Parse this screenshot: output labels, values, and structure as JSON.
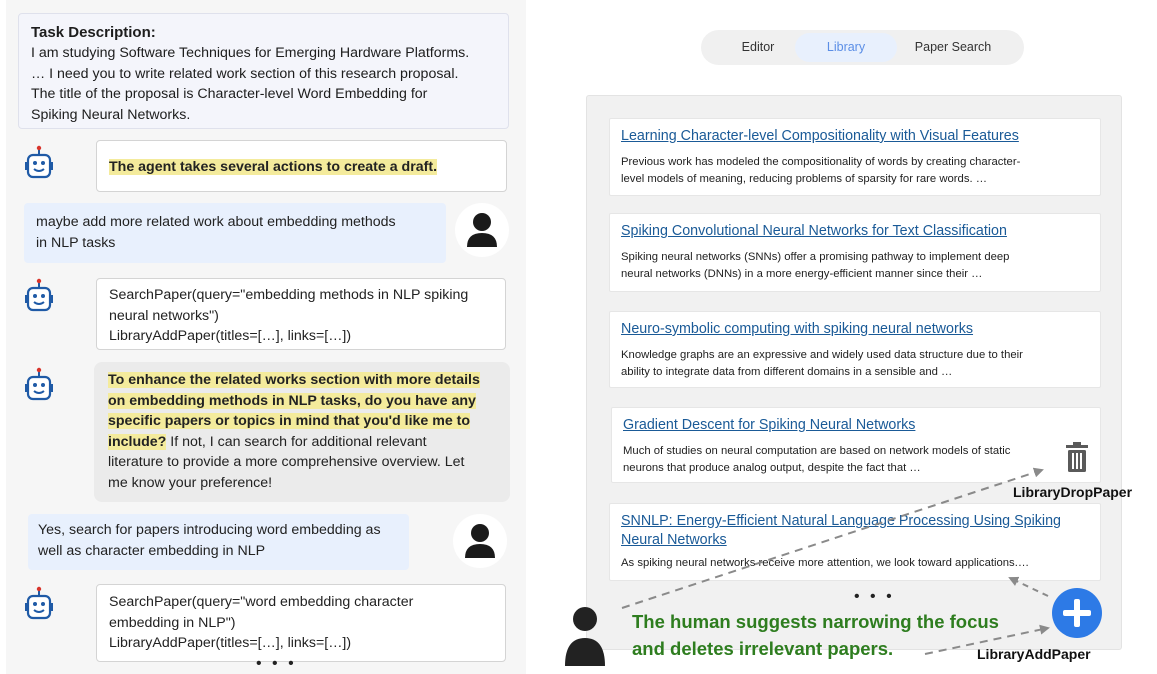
{
  "task": {
    "title": "Task Description:",
    "lines": [
      "I am studying Software Techniques for Emerging Hardware Platforms.",
      "… I need you to write related work section of this research proposal.",
      "The title of the proposal is Character-level Word Embedding for",
      "Spiking Neural Networks."
    ]
  },
  "chat": {
    "agent_action_summary": "The agent takes several actions to create a draft.",
    "user_msg_1": [
      "maybe add more related work about embedding methods",
      "in NLP tasks"
    ],
    "agent_code_1": [
      "SearchPaper(query=\"embedding methods in NLP spiking",
      "neural networks\")",
      "LibraryAddPaper(titles=[…], links=[…])"
    ],
    "agent_question": {
      "highlight": [
        "To enhance the related works section with more details",
        "on embedding methods in NLP tasks, do you have any",
        "specific papers or topics in mind that you'd like me to",
        "include?"
      ],
      "rest_first": " If not, I can search for additional relevant",
      "rest": [
        "literature to provide a more comprehensive overview. Let",
        "me know your preference!"
      ]
    },
    "user_msg_2": [
      "Yes, search for papers introducing word embedding as",
      "well as character embedding in NLP"
    ],
    "agent_code_2": [
      "SearchPaper(query=\"word embedding character",
      "embedding in NLP\")",
      "LibraryAddPaper(titles=[…], links=[…])"
    ],
    "more": "• • •"
  },
  "tabs": [
    "Editor",
    "Library",
    "Paper Search"
  ],
  "active_tab": "Library",
  "library": {
    "papers": [
      {
        "title": [
          "Learning Character-level Compositionality with Visual Features"
        ],
        "abstract": [
          "Previous work has modeled the compositionality of words by creating character-",
          "level models of meaning, reducing problems of sparsity for rare words. …"
        ]
      },
      {
        "title": [
          "Spiking Convolutional Neural Networks for Text Classification"
        ],
        "abstract": [
          "Spiking neural networks (SNNs) offer a promising pathway to implement deep",
          "neural networks (DNNs) in a more energy-efficient manner since their …"
        ]
      },
      {
        "title": [
          "Neuro-symbolic computing with spiking neural networks"
        ],
        "abstract": [
          "Knowledge graphs are an expressive and widely used data structure due to their",
          "ability to integrate data from different domains in a sensible and …"
        ]
      },
      {
        "title": [
          "Gradient Descent for Spiking Neural Networks"
        ],
        "abstract": [
          "Much of studies on neural computation are based on network models of static",
          "neurons that produce analog output, despite the fact that …"
        ]
      },
      {
        "title": [
          "SNNLP: Energy-Efficient Natural Language Processing Using Spiking",
          "Neural Networks"
        ],
        "abstract": [
          "As spiking neural networks receive more attention, we look toward applications.…"
        ]
      }
    ],
    "more": "• • •"
  },
  "actions": {
    "drop_label": "LibraryDropPaper",
    "add_label": "LibraryAddPaper",
    "caption": [
      "The human suggests narrowing the focus",
      "and deletes irrelevant papers."
    ]
  },
  "colors": {
    "highlight": "#f4eb9c",
    "user_bubble": "#e8f0fd",
    "link": "#1a5a97",
    "caption_green": "#2e7d1f",
    "add_button": "#2d7ae6",
    "tab_active_text": "#5b8ee6"
  },
  "icons": [
    "robot-icon",
    "person-icon",
    "trash-icon",
    "plus-icon"
  ]
}
